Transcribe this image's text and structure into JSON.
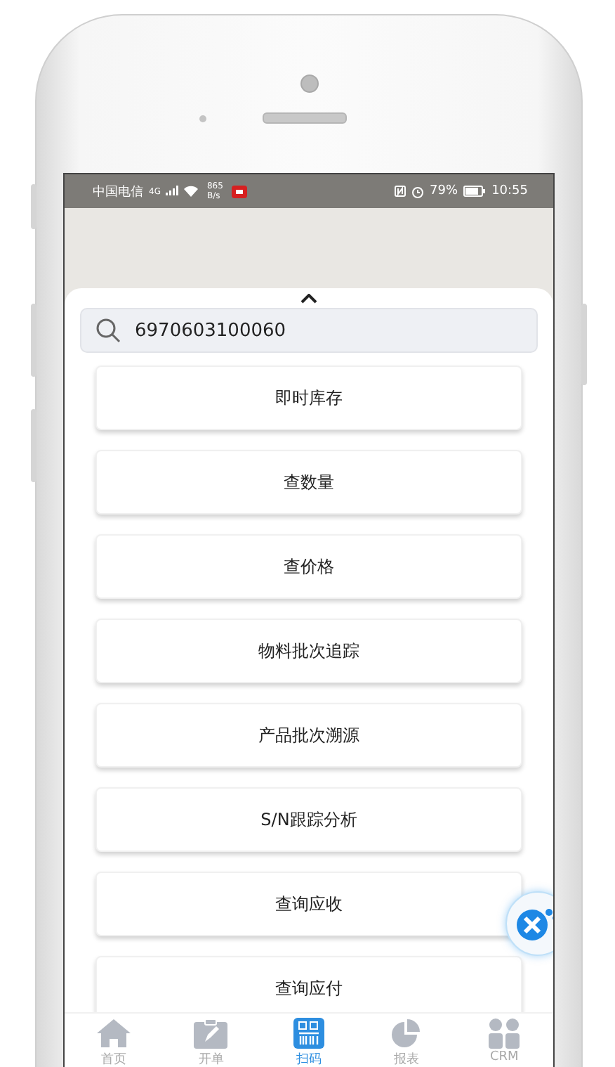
{
  "status_bar": {
    "carrier": "中国电信",
    "network": "4G",
    "speed_value": "865",
    "speed_unit": "B/s",
    "battery": "79%",
    "time": "10:55"
  },
  "search": {
    "value": "6970603100060"
  },
  "menu_items": [
    {
      "label": "即时库存"
    },
    {
      "label": "查数量"
    },
    {
      "label": "查价格"
    },
    {
      "label": "物料批次追踪"
    },
    {
      "label": "产品批次溯源"
    },
    {
      "label": "S/N跟踪分析"
    },
    {
      "label": "查询应收"
    },
    {
      "label": "查询应付"
    }
  ],
  "tab_bar": [
    {
      "label": "首页",
      "kind": "home",
      "selected": false
    },
    {
      "label": "开单",
      "kind": "order",
      "selected": false
    },
    {
      "label": "扫码",
      "kind": "scan",
      "selected": true
    },
    {
      "label": "报表",
      "kind": "report",
      "selected": false
    },
    {
      "label": "CRM",
      "kind": "crm",
      "selected": false
    }
  ]
}
